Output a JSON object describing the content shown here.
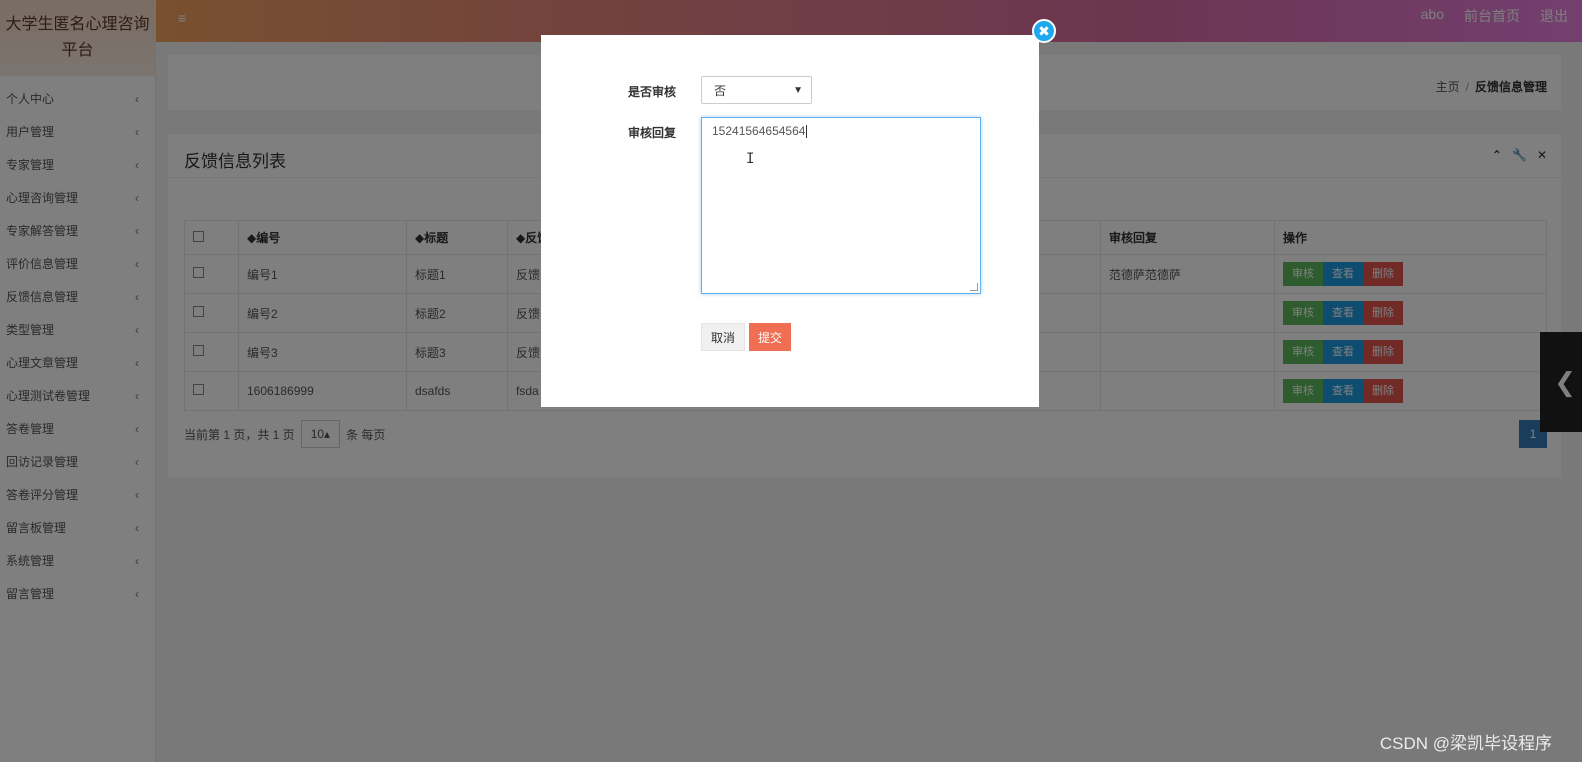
{
  "app": {
    "title": "大学生匿名心理咨询平台"
  },
  "sidebar": {
    "items": [
      {
        "label": "个人中心"
      },
      {
        "label": "用户管理"
      },
      {
        "label": "专家管理"
      },
      {
        "label": "心理咨询管理"
      },
      {
        "label": "专家解答管理"
      },
      {
        "label": "评价信息管理"
      },
      {
        "label": "反馈信息管理"
      },
      {
        "label": "类型管理"
      },
      {
        "label": "心理文章管理"
      },
      {
        "label": "心理测试卷管理"
      },
      {
        "label": "答卷管理"
      },
      {
        "label": "回访记录管理"
      },
      {
        "label": "答卷评分管理"
      },
      {
        "label": "留言板管理"
      },
      {
        "label": "系统管理"
      },
      {
        "label": "留言管理"
      }
    ],
    "chevron": "‹"
  },
  "topbar": {
    "menu_icon": "≡",
    "user": "abo",
    "home": "前台首页",
    "logout": "退出"
  },
  "breadcrumb": {
    "home": "主页",
    "sep": "/",
    "current": "反馈信息管理"
  },
  "list": {
    "title": "反馈信息列表",
    "columns": [
      "◆编号",
      "◆标题",
      "◆反馈",
      "审核回复",
      "操作"
    ],
    "rows": [
      {
        "id": "编号1",
        "title": "标题1",
        "content": "反馈",
        "reply": "范德萨范德萨"
      },
      {
        "id": "编号2",
        "title": "标题2",
        "content": "反馈",
        "reply": ""
      },
      {
        "id": "编号3",
        "title": "标题3",
        "content": "反馈",
        "reply": ""
      },
      {
        "id": "1606186999",
        "title": "dsafds",
        "content": "fsda",
        "reply": ""
      }
    ],
    "actions": {
      "review": "审核",
      "view": "查看",
      "delete": "删除"
    },
    "pager": {
      "info": "当前第 1 页，共 1 页",
      "page_size": "10",
      "per_page": "条 每页",
      "current_page": "1"
    }
  },
  "modal": {
    "review_label": "是否审核",
    "review_value": "否",
    "reply_label": "审核回复",
    "reply_value": "15241564654564",
    "cancel": "取消",
    "submit": "提交"
  },
  "watermark": "CSDN @梁凯毕设程序",
  "colors": {
    "topbar_start": "#f1a35f",
    "topbar_end": "#e57fe0",
    "review": "#5cb85c",
    "view": "#1c9ae0",
    "delete": "#e2554d",
    "submit": "#f06f52",
    "close": "#1ea9ee"
  }
}
